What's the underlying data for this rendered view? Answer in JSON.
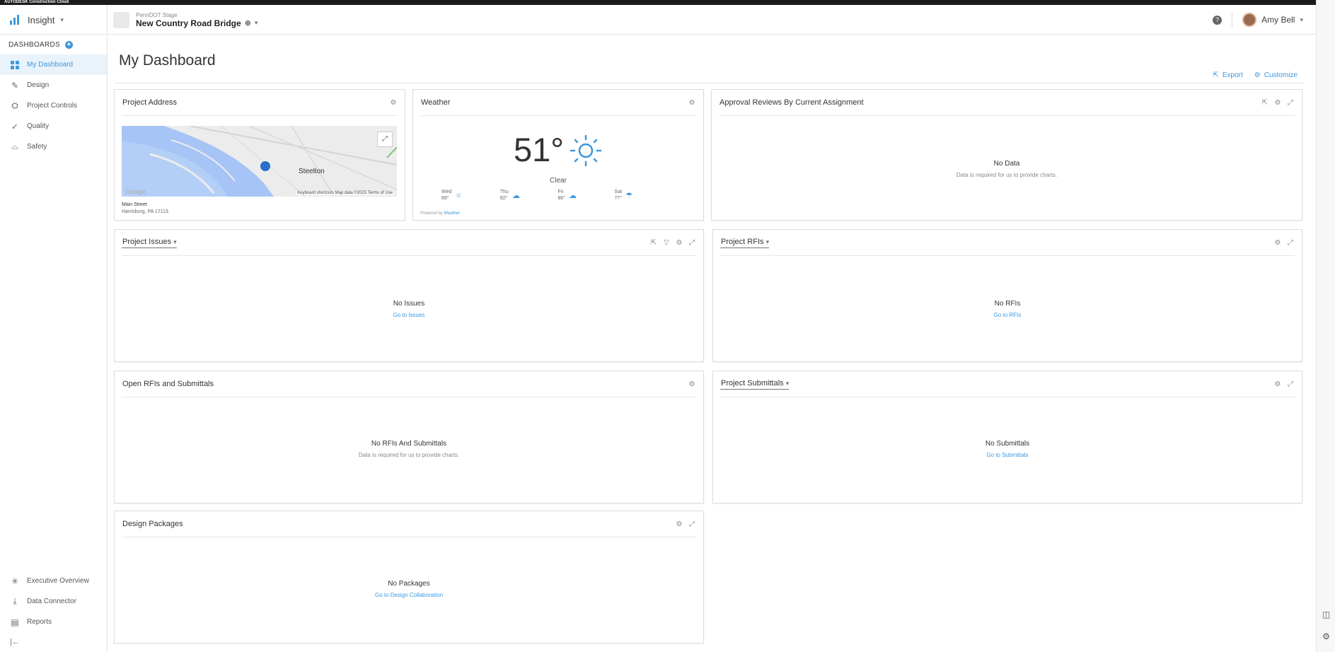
{
  "topbar": {
    "brand": "AUTODESK Construction Cloud"
  },
  "header": {
    "app_name": "Insight",
    "project_org": "PennDOT Stage",
    "project_name": "New Country Road Bridge",
    "user_name": "Amy Bell"
  },
  "sidebar": {
    "heading": "DASHBOARDS",
    "items": [
      {
        "label": "My Dashboard",
        "icon": "grid-icon"
      },
      {
        "label": "Design",
        "icon": "edit-icon"
      },
      {
        "label": "Project Controls",
        "icon": "hierarchy-icon"
      },
      {
        "label": "Quality",
        "icon": "check-icon"
      },
      {
        "label": "Safety",
        "icon": "helmet-icon"
      }
    ],
    "bottom_items": [
      {
        "label": "Executive Overview",
        "icon": "sparkle-icon"
      },
      {
        "label": "Data Connector",
        "icon": "download-icon"
      },
      {
        "label": "Reports",
        "icon": "report-icon"
      }
    ]
  },
  "main": {
    "title": "My Dashboard",
    "export_label": "Export",
    "customize_label": "Customize"
  },
  "cards": {
    "address": {
      "title": "Project Address",
      "city": "Steelton",
      "attribution": "Keyboard shortcuts   Map data ©2023   Terms of Use",
      "google": "Google",
      "street": "Main Street",
      "city_state": "Harrisburg, PA 17113"
    },
    "weather": {
      "title": "Weather",
      "temp": "51°",
      "condition": "Clear",
      "forecast": [
        {
          "day": "Wed",
          "temp": "69°",
          "icon": "sun-icon"
        },
        {
          "day": "Thu",
          "temp": "82°",
          "icon": "cloud-icon"
        },
        {
          "day": "Fri",
          "temp": "86°",
          "icon": "cloud-icon"
        },
        {
          "day": "Sat",
          "temp": "77°",
          "icon": "rain-icon"
        }
      ],
      "powered_by": "Powered by",
      "provider": "Weather"
    },
    "approval": {
      "title": "Approval Reviews By Current Assignment",
      "empty_title": "No Data",
      "empty_sub": "Data is required for us to provide charts."
    },
    "issues": {
      "title": "Project Issues",
      "empty_title": "No Issues",
      "empty_link": "Go to Issues"
    },
    "rfis": {
      "title": "Project RFIs",
      "empty_title": "No RFIs",
      "empty_link": "Go to RFIs"
    },
    "open_rfis": {
      "title": "Open RFIs and Submittals",
      "empty_title": "No RFIs And Submittals",
      "empty_sub": "Data is required for us to provide charts."
    },
    "submittals": {
      "title": "Project Submittals",
      "empty_title": "No Submittals",
      "empty_link": "Go to Submittals"
    },
    "packages": {
      "title": "Design Packages",
      "empty_title": "No Packages",
      "empty_link": "Go to Design Collaboration"
    }
  },
  "colors": {
    "accent": "#3c97dd",
    "active_bg": "#e9f3fb",
    "map_water": "#a6c4f5",
    "page_bg": "#b9c6e8"
  }
}
